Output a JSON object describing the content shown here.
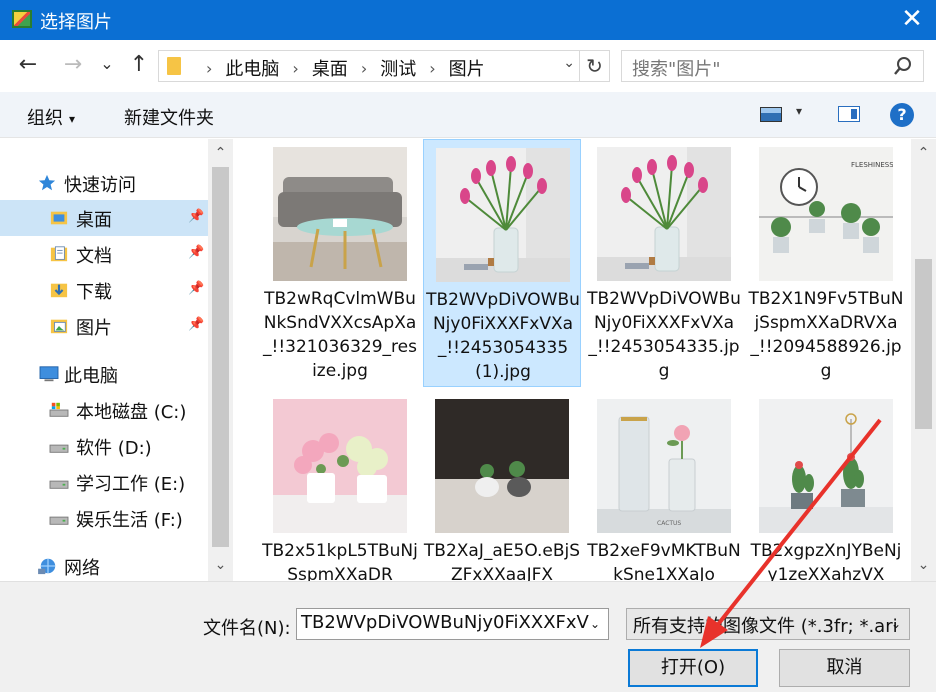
{
  "window": {
    "title": "选择图片",
    "close_glyph": "✕"
  },
  "nav": {
    "back_glyph": "←",
    "forward_glyph": "→",
    "history_glyph": "⌄",
    "up_glyph": "↑",
    "crumbs": [
      "此电脑",
      "桌面",
      "测试",
      "图片"
    ],
    "crumb_sep": "›",
    "dropdown_glyph": "⌄",
    "refresh_glyph": "↻",
    "search_placeholder": "搜索\"图片\""
  },
  "toolbar": {
    "organize_label": "组织",
    "organize_caret": "▾",
    "new_folder_label": "新建文件夹",
    "view_caret": "▾",
    "help_glyph": "?"
  },
  "sidebar": {
    "items": [
      {
        "label": "快速访问",
        "icon": "star-icon",
        "indent": 0,
        "pinned": false,
        "selected": false
      },
      {
        "label": "桌面",
        "icon": "folder-desktop-icon",
        "indent": 1,
        "pinned": true,
        "selected": true
      },
      {
        "label": "文档",
        "icon": "documents-icon",
        "indent": 1,
        "pinned": true,
        "selected": false
      },
      {
        "label": "下载",
        "icon": "downloads-icon",
        "indent": 1,
        "pinned": true,
        "selected": false
      },
      {
        "label": "图片",
        "icon": "pictures-icon",
        "indent": 1,
        "pinned": true,
        "selected": false
      },
      {
        "label": "此电脑",
        "icon": "computer-icon",
        "indent": 0,
        "pinned": false,
        "selected": false
      },
      {
        "label": "本地磁盘 (C:)",
        "icon": "drive-c-icon",
        "indent": 1,
        "pinned": false,
        "selected": false
      },
      {
        "label": "软件 (D:)",
        "icon": "drive-icon",
        "indent": 1,
        "pinned": false,
        "selected": false
      },
      {
        "label": "学习工作 (E:)",
        "icon": "drive-icon",
        "indent": 1,
        "pinned": false,
        "selected": false
      },
      {
        "label": "娱乐生活 (F:)",
        "icon": "drive-icon",
        "indent": 1,
        "pinned": false,
        "selected": false
      },
      {
        "label": "网络",
        "icon": "network-icon",
        "indent": 0,
        "pinned": false,
        "selected": false
      }
    ]
  },
  "files": [
    {
      "name": "TB2wRqCvlmWBuNkSndVXXcsApXa_!!321036329_resize.jpg",
      "thumb": "sofa",
      "selected": false
    },
    {
      "name": "TB2WVpDiVOWBuNjy0FiXXXFxVXa_!!2453054335 (1).jpg",
      "thumb": "tulip",
      "selected": true
    },
    {
      "name": "TB2WVpDiVOWBuNjy0FiXXXFxVXa_!!2453054335.jpg",
      "thumb": "tulip",
      "selected": false
    },
    {
      "name": "TB2X1N9Fv5TBuNjSspmXXaDRVXa_!!2094588926.jpg",
      "thumb": "plants",
      "selected": false
    },
    {
      "name": "TB2x51kpL5TBuNjSspmXXaDR",
      "thumb": "flowers",
      "selected": false
    },
    {
      "name": "TB2XaJ_aE5O.eBjSZFxXXaaJFX",
      "thumb": "succulent",
      "selected": false
    },
    {
      "name": "TB2xeF9vMKTBuNkSne1XXaJo",
      "thumb": "rose",
      "selected": false
    },
    {
      "name": "TB2xgpzXnJYBeNjy1zeXXahzVX",
      "thumb": "cactus",
      "selected": false
    }
  ],
  "thumb_texts": {
    "plants_title": "FLESHINESS POTTED",
    "cactus_caption": "CACTUS"
  },
  "bottom": {
    "filename_label": "文件名(N):",
    "filename_value": "TB2WVpDiVOWBuNjy0FiXXXFxV",
    "dropdown_glyph": "⌄",
    "filter_value": "所有支持的图像文件 (*.3fr; *.ari",
    "open_label": "打开(O)",
    "cancel_label": "取消"
  },
  "scroll": {
    "up_glyph": "⌃",
    "down_glyph": "⌄"
  },
  "colors": {
    "titlebar": "#0b6fd3",
    "selection": "#cce8ff",
    "annotation_arrow": "#e8322b"
  }
}
